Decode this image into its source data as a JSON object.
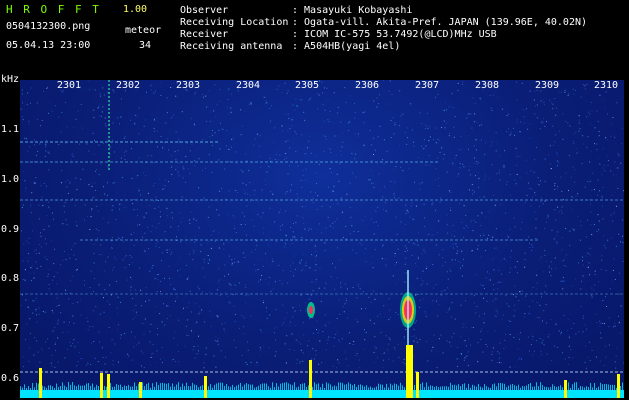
{
  "header": {
    "app_title": "H R O F F T",
    "version": "1.00",
    "filename": "0504132300.png",
    "meteor_label": "meteor",
    "meteor_count": "34",
    "datetime": "05.04.13 23:00",
    "info_labels": [
      "Observer",
      "Receiving Location",
      "Receiver",
      "Receiving antenna"
    ],
    "info_values": [
      ": Masayuki Kobayashi",
      ": Ogata-vill. Akita-Pref. JAPAN (139.96E, 40.02N)",
      ": ICOM IC-575 53.7492(@LCD)MHz USB",
      ": A504HB(yagi 4el)"
    ]
  },
  "spectrogram": {
    "y_unit": "kHz",
    "y_ticks": [
      "1.1",
      "1.0",
      "0.9",
      "0.8",
      "0.7",
      "0.6"
    ],
    "x_ticks": [
      "2301",
      "2302",
      "2303",
      "2304",
      "2305",
      "2306",
      "2307",
      "2308",
      "2309",
      "2310"
    ]
  },
  "colors": {
    "background": "#071666",
    "noise_light": "#5a8cff",
    "bursts": "#FFFF00",
    "baseline": "#00E5FF",
    "hot_echo": "#FF2A5A",
    "hot_echo_mid": "#FFD000",
    "hot_echo_outer": "#00FF90"
  }
}
